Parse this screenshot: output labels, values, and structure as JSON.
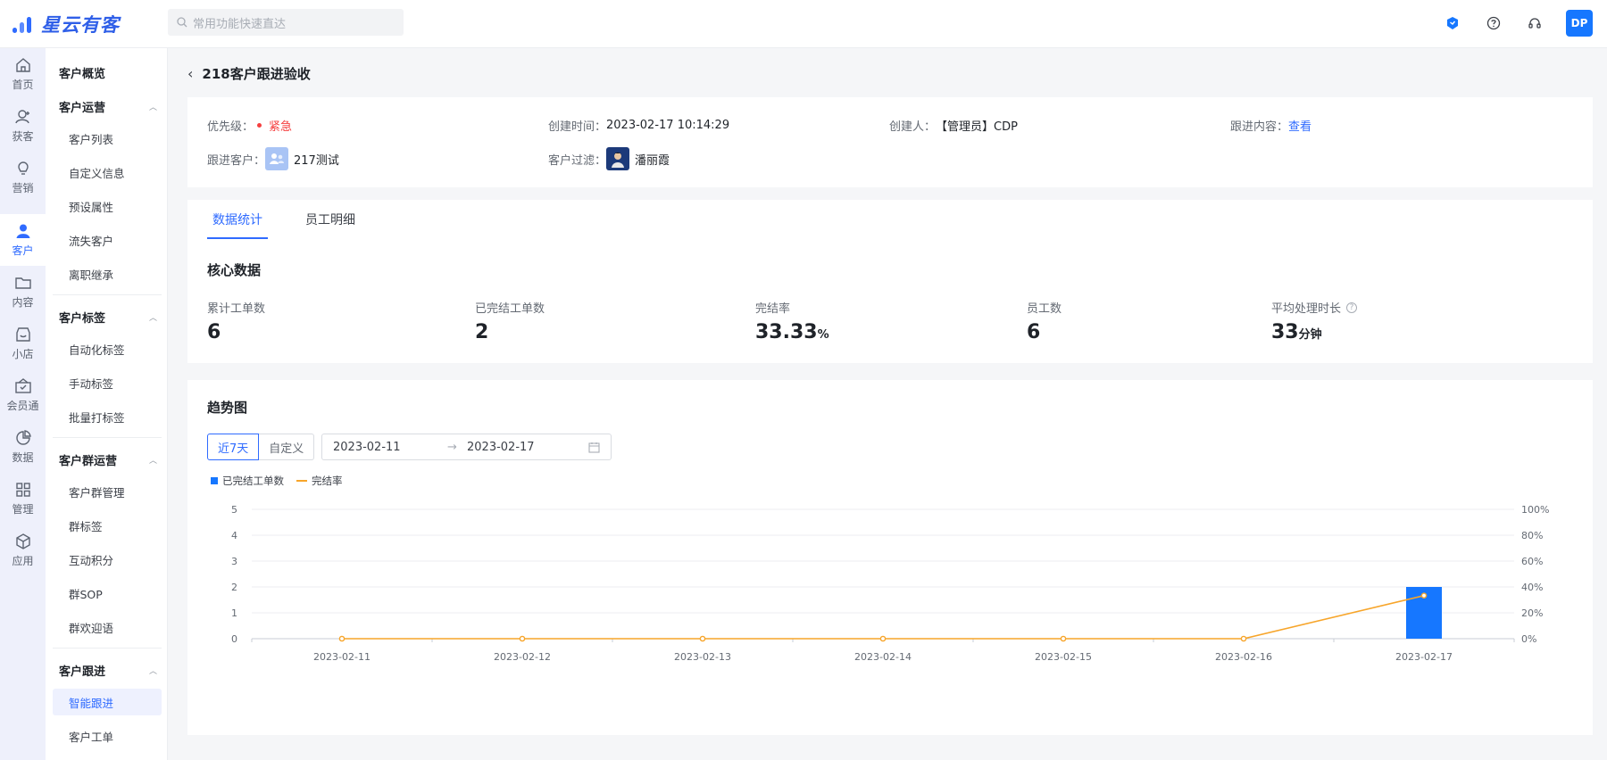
{
  "app": {
    "logo_text": "星云有客",
    "search_placeholder": "常用功能快速直达",
    "user_initials": "DP"
  },
  "rail": [
    {
      "label": "首页",
      "icon": "home-icon"
    },
    {
      "label": "获客",
      "icon": "user-add-icon"
    },
    {
      "label": "营销",
      "icon": "bulb-icon"
    },
    {
      "label": "客户",
      "icon": "user-icon",
      "active": true
    },
    {
      "label": "内容",
      "icon": "folder-icon"
    },
    {
      "label": "小店",
      "icon": "shop-icon"
    },
    {
      "label": "会员通",
      "icon": "member-icon"
    },
    {
      "label": "数据",
      "icon": "pie-icon"
    },
    {
      "label": "管理",
      "icon": "grid-icon"
    },
    {
      "label": "应用",
      "icon": "cube-icon"
    }
  ],
  "subnav": {
    "overview": "客户概览",
    "groups": [
      {
        "title": "客户运营",
        "items": [
          "客户列表",
          "自定义信息",
          "预设属性",
          "流失客户",
          "离职继承"
        ]
      },
      {
        "title": "客户标签",
        "items": [
          "自动化标签",
          "手动标签",
          "批量打标签"
        ]
      },
      {
        "title": "客户群运营",
        "items": [
          "客户群管理",
          "群标签",
          "互动积分",
          "群SOP",
          "群欢迎语"
        ]
      },
      {
        "title": "客户跟进",
        "items": [
          "智能跟进",
          "客户工单"
        ]
      }
    ],
    "active_item": "智能跟进"
  },
  "page": {
    "title": "218客户跟进验收",
    "info": {
      "priority_label": "优先级：",
      "priority_value": "紧急",
      "created_time_label": "创建时间：",
      "created_time_value": "2023-02-17 10:14:29",
      "creator_label": "创建人：",
      "creator_value": "【管理员】CDP",
      "content_label": "跟进内容：",
      "content_link": "查看",
      "customer_label": "跟进客户：",
      "customer_value": "217测试",
      "filter_label": "客户过滤：",
      "filter_value": "潘丽霞"
    },
    "tabs": [
      "数据统计",
      "员工明细"
    ],
    "active_tab": "数据统计",
    "core_title": "核心数据",
    "kpis": [
      {
        "label": "累计工单数",
        "value": "6",
        "unit": ""
      },
      {
        "label": "已完结工单数",
        "value": "2",
        "unit": ""
      },
      {
        "label": "完结率",
        "value": "33.33",
        "unit": "%"
      },
      {
        "label": "员工数",
        "value": "6",
        "unit": ""
      },
      {
        "label": "平均处理时长",
        "value": "33",
        "unit": "分钟",
        "help": "?"
      }
    ],
    "trend": {
      "title": "趋势图",
      "range_options": [
        "近7天",
        "自定义"
      ],
      "active_range": "近7天",
      "date_start": "2023-02-11",
      "date_arrow": "→",
      "date_end": "2023-02-17"
    }
  },
  "colors": {
    "accent": "#2f6bff",
    "bar": "#1677ff",
    "line": "#f7a52a",
    "urgent": "#f53f3f"
  },
  "chart_data": {
    "type": "bar",
    "categories": [
      "2023-02-11",
      "2023-02-12",
      "2023-02-13",
      "2023-02-14",
      "2023-02-15",
      "2023-02-16",
      "2023-02-17"
    ],
    "series": [
      {
        "name": "已完结工单数",
        "type": "bar",
        "axis": "left",
        "values": [
          0,
          0,
          0,
          0,
          0,
          0,
          2
        ]
      },
      {
        "name": "完结率",
        "type": "line",
        "axis": "right",
        "values": [
          0,
          0,
          0,
          0,
          0,
          0,
          33.33
        ]
      }
    ],
    "y_left": {
      "min": 0,
      "max": 5,
      "ticks": [
        "0",
        "1",
        "2",
        "3",
        "4",
        "5"
      ]
    },
    "y_right": {
      "min": 0,
      "max": 100,
      "ticks": [
        "0%",
        "20%",
        "40%",
        "60%",
        "80%",
        "100%"
      ]
    },
    "legend_position": "top-left",
    "grid": true
  }
}
